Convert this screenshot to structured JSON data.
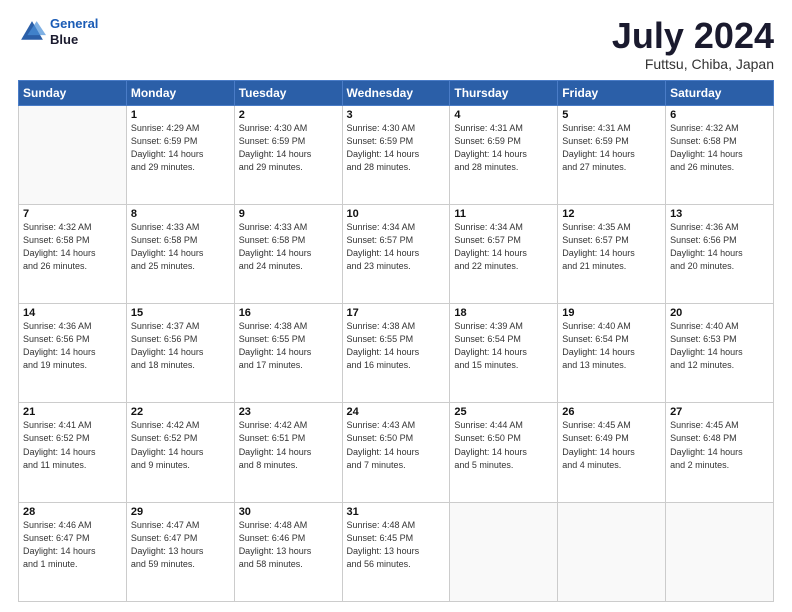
{
  "logo": {
    "line1": "General",
    "line2": "Blue"
  },
  "title": "July 2024",
  "subtitle": "Futtsu, Chiba, Japan",
  "days_of_week": [
    "Sunday",
    "Monday",
    "Tuesday",
    "Wednesday",
    "Thursday",
    "Friday",
    "Saturday"
  ],
  "weeks": [
    [
      {
        "day": "",
        "info": ""
      },
      {
        "day": "1",
        "info": "Sunrise: 4:29 AM\nSunset: 6:59 PM\nDaylight: 14 hours\nand 29 minutes."
      },
      {
        "day": "2",
        "info": "Sunrise: 4:30 AM\nSunset: 6:59 PM\nDaylight: 14 hours\nand 29 minutes."
      },
      {
        "day": "3",
        "info": "Sunrise: 4:30 AM\nSunset: 6:59 PM\nDaylight: 14 hours\nand 28 minutes."
      },
      {
        "day": "4",
        "info": "Sunrise: 4:31 AM\nSunset: 6:59 PM\nDaylight: 14 hours\nand 28 minutes."
      },
      {
        "day": "5",
        "info": "Sunrise: 4:31 AM\nSunset: 6:59 PM\nDaylight: 14 hours\nand 27 minutes."
      },
      {
        "day": "6",
        "info": "Sunrise: 4:32 AM\nSunset: 6:58 PM\nDaylight: 14 hours\nand 26 minutes."
      }
    ],
    [
      {
        "day": "7",
        "info": "Sunrise: 4:32 AM\nSunset: 6:58 PM\nDaylight: 14 hours\nand 26 minutes."
      },
      {
        "day": "8",
        "info": "Sunrise: 4:33 AM\nSunset: 6:58 PM\nDaylight: 14 hours\nand 25 minutes."
      },
      {
        "day": "9",
        "info": "Sunrise: 4:33 AM\nSunset: 6:58 PM\nDaylight: 14 hours\nand 24 minutes."
      },
      {
        "day": "10",
        "info": "Sunrise: 4:34 AM\nSunset: 6:57 PM\nDaylight: 14 hours\nand 23 minutes."
      },
      {
        "day": "11",
        "info": "Sunrise: 4:34 AM\nSunset: 6:57 PM\nDaylight: 14 hours\nand 22 minutes."
      },
      {
        "day": "12",
        "info": "Sunrise: 4:35 AM\nSunset: 6:57 PM\nDaylight: 14 hours\nand 21 minutes."
      },
      {
        "day": "13",
        "info": "Sunrise: 4:36 AM\nSunset: 6:56 PM\nDaylight: 14 hours\nand 20 minutes."
      }
    ],
    [
      {
        "day": "14",
        "info": "Sunrise: 4:36 AM\nSunset: 6:56 PM\nDaylight: 14 hours\nand 19 minutes."
      },
      {
        "day": "15",
        "info": "Sunrise: 4:37 AM\nSunset: 6:56 PM\nDaylight: 14 hours\nand 18 minutes."
      },
      {
        "day": "16",
        "info": "Sunrise: 4:38 AM\nSunset: 6:55 PM\nDaylight: 14 hours\nand 17 minutes."
      },
      {
        "day": "17",
        "info": "Sunrise: 4:38 AM\nSunset: 6:55 PM\nDaylight: 14 hours\nand 16 minutes."
      },
      {
        "day": "18",
        "info": "Sunrise: 4:39 AM\nSunset: 6:54 PM\nDaylight: 14 hours\nand 15 minutes."
      },
      {
        "day": "19",
        "info": "Sunrise: 4:40 AM\nSunset: 6:54 PM\nDaylight: 14 hours\nand 13 minutes."
      },
      {
        "day": "20",
        "info": "Sunrise: 4:40 AM\nSunset: 6:53 PM\nDaylight: 14 hours\nand 12 minutes."
      }
    ],
    [
      {
        "day": "21",
        "info": "Sunrise: 4:41 AM\nSunset: 6:52 PM\nDaylight: 14 hours\nand 11 minutes."
      },
      {
        "day": "22",
        "info": "Sunrise: 4:42 AM\nSunset: 6:52 PM\nDaylight: 14 hours\nand 9 minutes."
      },
      {
        "day": "23",
        "info": "Sunrise: 4:42 AM\nSunset: 6:51 PM\nDaylight: 14 hours\nand 8 minutes."
      },
      {
        "day": "24",
        "info": "Sunrise: 4:43 AM\nSunset: 6:50 PM\nDaylight: 14 hours\nand 7 minutes."
      },
      {
        "day": "25",
        "info": "Sunrise: 4:44 AM\nSunset: 6:50 PM\nDaylight: 14 hours\nand 5 minutes."
      },
      {
        "day": "26",
        "info": "Sunrise: 4:45 AM\nSunset: 6:49 PM\nDaylight: 14 hours\nand 4 minutes."
      },
      {
        "day": "27",
        "info": "Sunrise: 4:45 AM\nSunset: 6:48 PM\nDaylight: 14 hours\nand 2 minutes."
      }
    ],
    [
      {
        "day": "28",
        "info": "Sunrise: 4:46 AM\nSunset: 6:47 PM\nDaylight: 14 hours\nand 1 minute."
      },
      {
        "day": "29",
        "info": "Sunrise: 4:47 AM\nSunset: 6:47 PM\nDaylight: 13 hours\nand 59 minutes."
      },
      {
        "day": "30",
        "info": "Sunrise: 4:48 AM\nSunset: 6:46 PM\nDaylight: 13 hours\nand 58 minutes."
      },
      {
        "day": "31",
        "info": "Sunrise: 4:48 AM\nSunset: 6:45 PM\nDaylight: 13 hours\nand 56 minutes."
      },
      {
        "day": "",
        "info": ""
      },
      {
        "day": "",
        "info": ""
      },
      {
        "day": "",
        "info": ""
      }
    ]
  ]
}
